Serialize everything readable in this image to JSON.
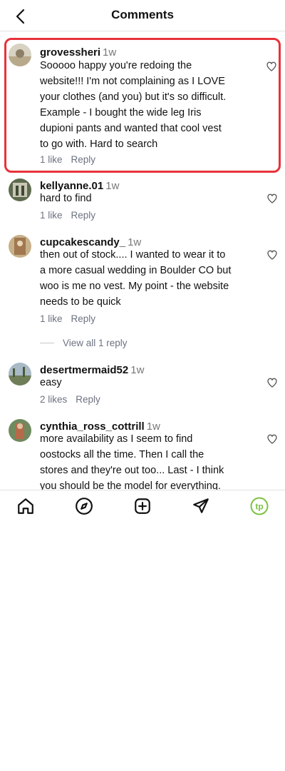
{
  "header": {
    "title": "Comments"
  },
  "comments": [
    {
      "username": "grovessheri",
      "time": "1w",
      "lines": [
        "Sooooo happy you're redoing the",
        "website!!! I'm not complaining as I LOVE",
        "your clothes (and you) but it's so difficult.",
        "Example - I bought the wide leg Iris",
        "dupioni pants and wanted that cool vest",
        "to go with. Hard to search"
      ],
      "likes": "1 like",
      "reply": "Reply"
    },
    {
      "username": "kellyanne.01",
      "time": "1w",
      "lines": [
        "hard to find"
      ],
      "likes": "1 like",
      "reply": "Reply"
    },
    {
      "username": "cupcakescandy_",
      "time": "1w",
      "lines": [
        "then out of stock.... I wanted to wear it to",
        "a more casual wedding in Boulder CO but",
        "woo is me no vest. My point - the website",
        "needs to be quick"
      ],
      "likes": "1 like",
      "reply": "Reply",
      "view_replies": "View all 1 reply"
    },
    {
      "username": "desertmermaid52",
      "time": "1w",
      "lines": [
        "easy"
      ],
      "likes": "2 likes",
      "reply": "Reply"
    },
    {
      "username": "cynthia_ross_cottrill",
      "time": "1w",
      "lines": [
        "more availability as I seem to find",
        "oostocks all the time. Then I call the",
        "stores and they're out too... Last - I think",
        "you should be the model for everything."
      ]
    }
  ],
  "nav": {
    "icons": [
      "home-icon",
      "explore-icon",
      "create-icon",
      "send-icon",
      "profile-avatar"
    ],
    "profile_initials": "tp"
  },
  "colors": {
    "highlight": "#e8323c",
    "profile_accent": "#7cc242"
  }
}
